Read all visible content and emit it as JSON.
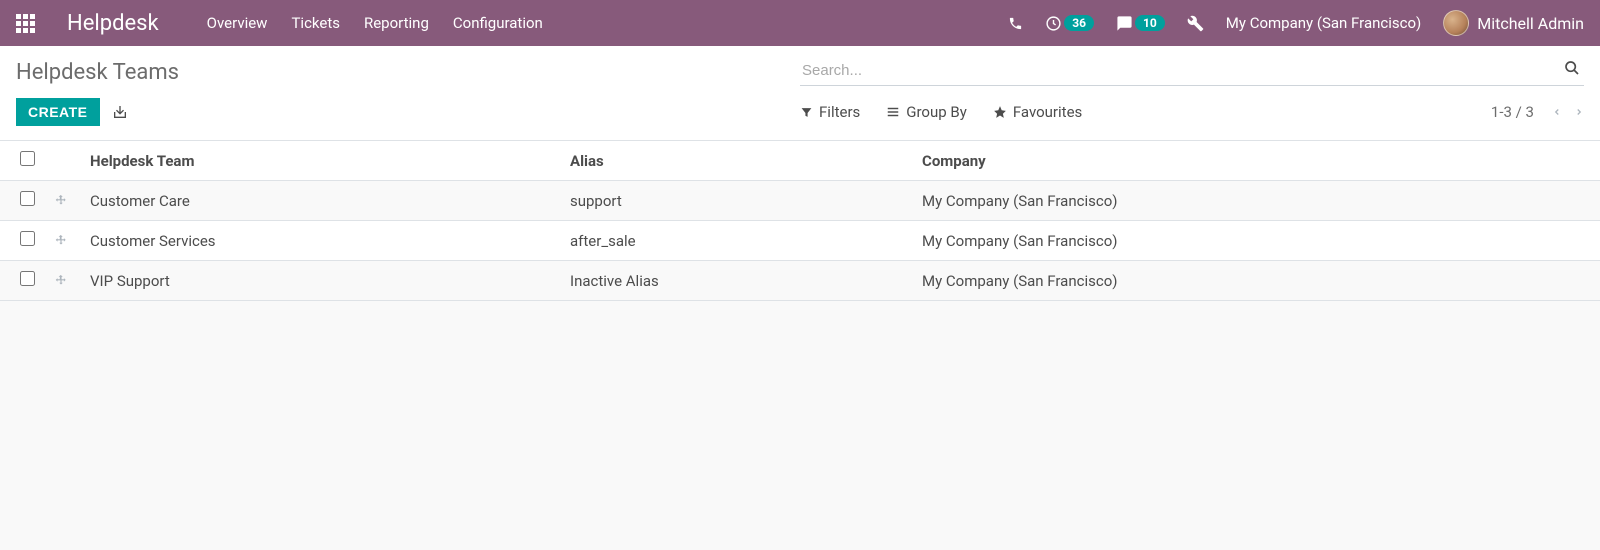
{
  "navbar": {
    "app_title": "Helpdesk",
    "links": [
      "Overview",
      "Tickets",
      "Reporting",
      "Configuration"
    ],
    "activities_badge": "36",
    "discuss_badge": "10",
    "company": "My Company (San Francisco)",
    "user": "Mitchell Admin"
  },
  "breadcrumb": "Helpdesk Teams",
  "search": {
    "placeholder": "Search..."
  },
  "buttons": {
    "create": "CREATE"
  },
  "toolbar": {
    "filters": "Filters",
    "group_by": "Group By",
    "favourites": "Favourites"
  },
  "pager": {
    "text": "1-3 / 3"
  },
  "table": {
    "headers": {
      "team": "Helpdesk Team",
      "alias": "Alias",
      "company": "Company"
    },
    "rows": [
      {
        "team": "Customer Care",
        "alias": "support",
        "company": "My Company (San Francisco)"
      },
      {
        "team": "Customer Services",
        "alias": "after_sale",
        "company": "My Company (San Francisco)"
      },
      {
        "team": "VIP Support",
        "alias": "Inactive Alias",
        "company": "My Company (San Francisco)"
      }
    ]
  }
}
